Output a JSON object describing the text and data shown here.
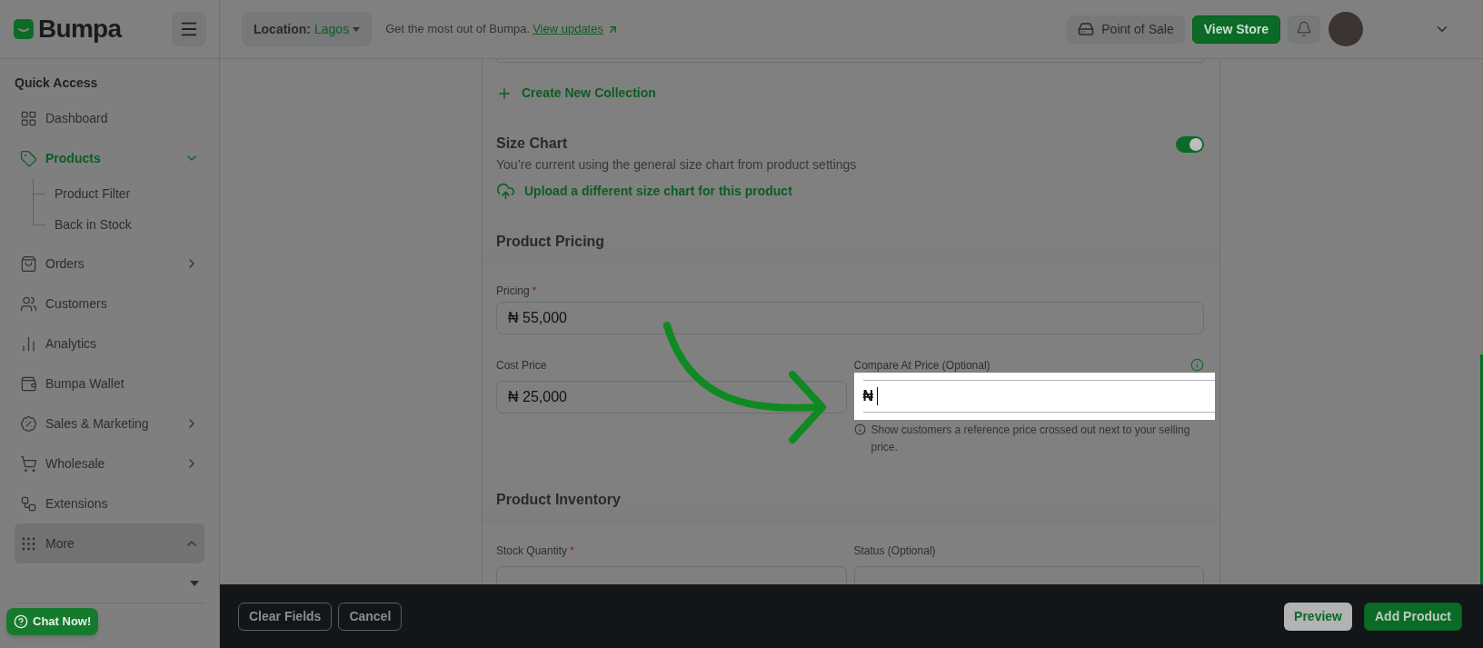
{
  "header": {
    "logo": "Bumpa",
    "location_label": "Location:",
    "location_value": "Lagos",
    "tagline": "Get the most out of Bumpa.",
    "updates_link": "View updates",
    "point_of_sale": "Point of Sale",
    "view_store": "View Store"
  },
  "sidebar": {
    "section_title": "Quick Access",
    "items": [
      {
        "label": "Dashboard",
        "selected": false,
        "highlighted": false
      },
      {
        "label": "Products",
        "selected": true,
        "highlighted": false,
        "expanded": true,
        "children": [
          {
            "label": "Product Filter"
          },
          {
            "label": "Back in Stock"
          }
        ]
      },
      {
        "label": "Orders",
        "selected": false,
        "highlighted": false,
        "expanded": false
      },
      {
        "label": "Customers",
        "selected": false,
        "highlighted": false
      },
      {
        "label": "Analytics",
        "selected": false,
        "highlighted": false
      },
      {
        "label": "Bumpa Wallet",
        "selected": false,
        "highlighted": false
      },
      {
        "label": "Sales & Marketing",
        "selected": false,
        "highlighted": false,
        "expanded": false
      },
      {
        "label": "Wholesale",
        "selected": false,
        "highlighted": false,
        "expanded": false
      },
      {
        "label": "Extensions",
        "selected": false,
        "highlighted": false
      },
      {
        "label": "More",
        "selected": false,
        "highlighted": true,
        "expanded": true
      }
    ],
    "chat_button": "Chat Now!"
  },
  "form": {
    "collection_link": "Create New Collection",
    "size_chart": {
      "title": "Size Chart",
      "description": "You’re current using the general size chart from product settings",
      "upload_link": "Upload a different size chart for this product",
      "on": true
    },
    "pricing": {
      "heading": "Product Pricing",
      "price": {
        "label": "Pricing",
        "required_mark": "*",
        "value": "₦ 55,000"
      },
      "cost": {
        "label": "Cost Price",
        "value": "₦ 25,000"
      },
      "compare": {
        "label": "Compare At Price (Optional)",
        "value": "₦",
        "focused": true,
        "help": "Show customers a reference price crossed out next to your selling price."
      }
    },
    "inventory": {
      "heading": "Product Inventory",
      "fields": [
        {
          "label": "Stock Quantity",
          "required_mark": "*"
        },
        {
          "label": "Status (Optional)"
        }
      ]
    }
  },
  "footer": {
    "buttons": [
      {
        "label": "Clear Fields",
        "kind": "outline"
      },
      {
        "label": "Cancel",
        "kind": "outline"
      },
      {
        "label": "Preview",
        "kind": "light"
      },
      {
        "label": "Add Product",
        "kind": "primary"
      }
    ]
  }
}
